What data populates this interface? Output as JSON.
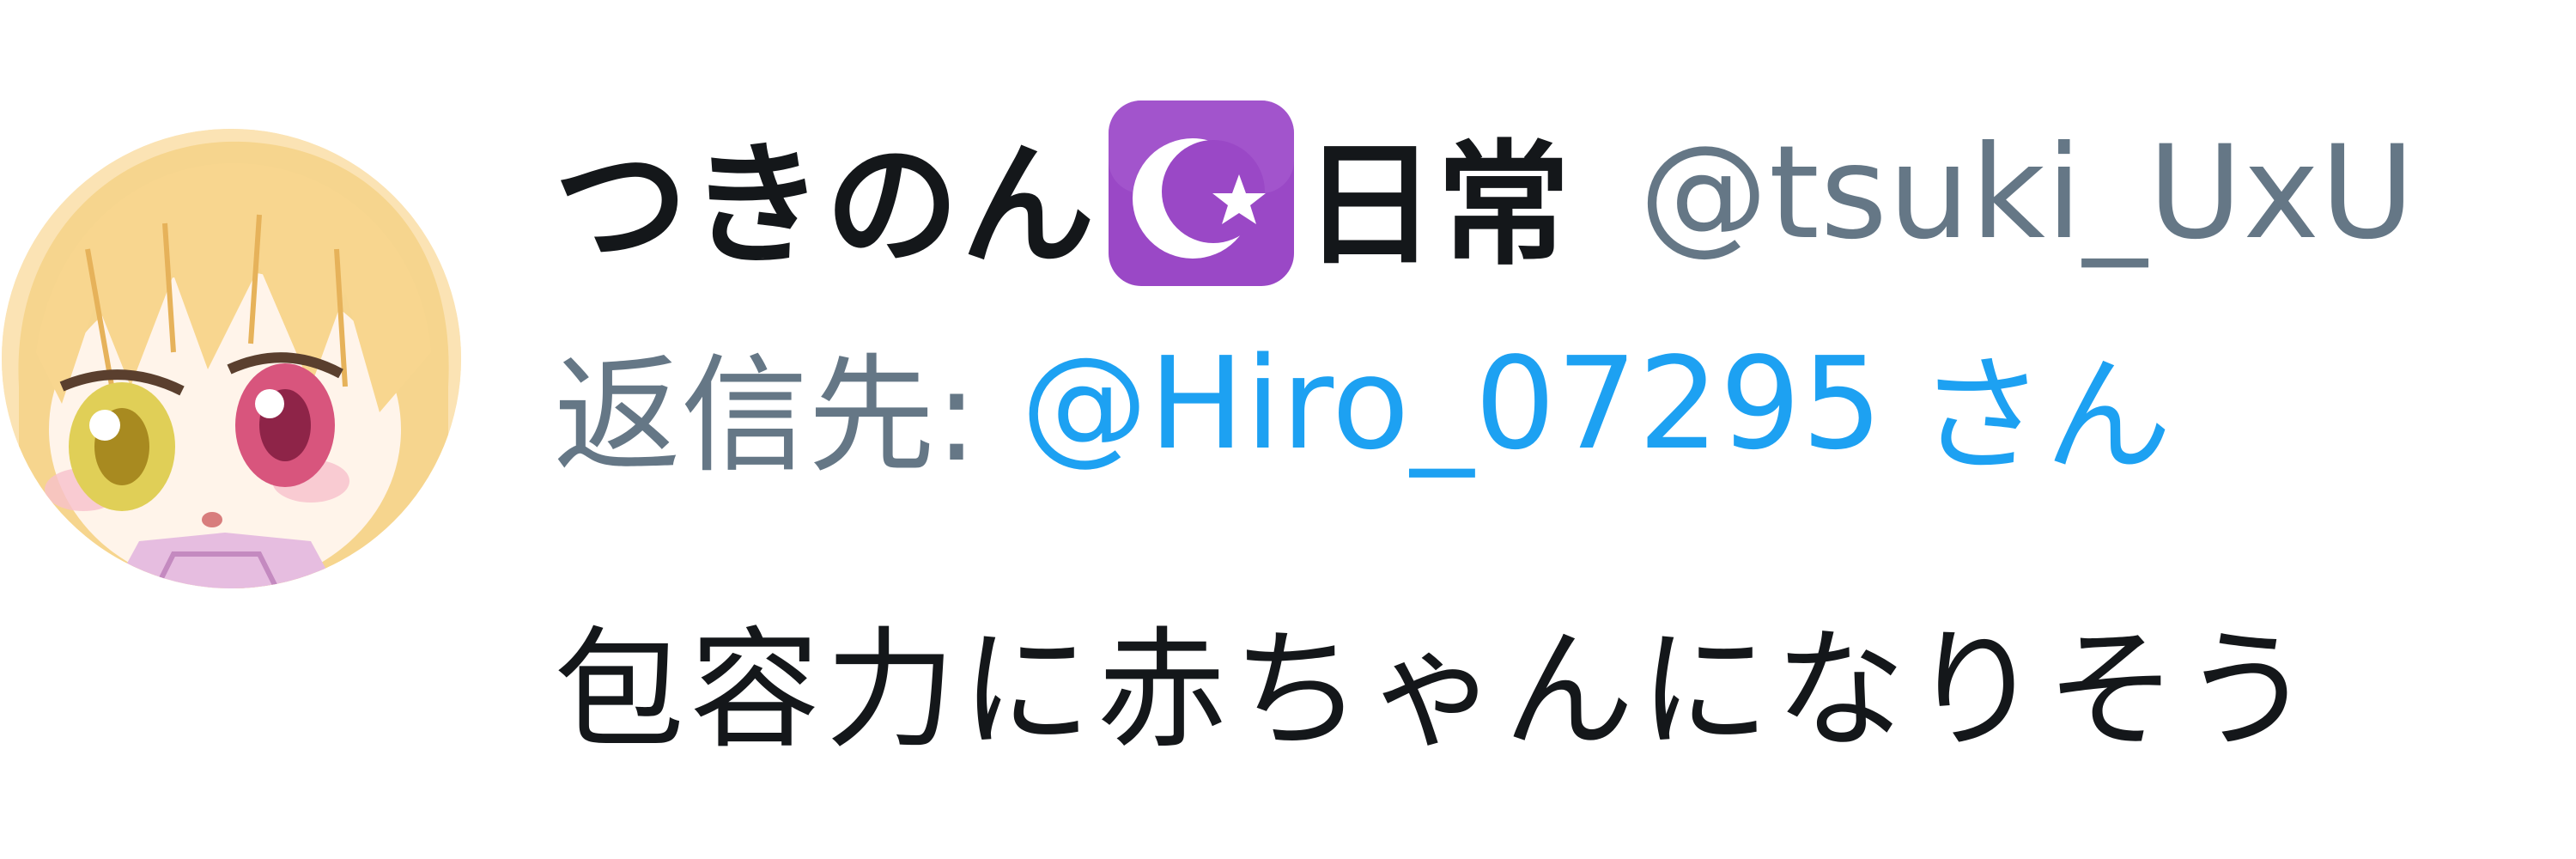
{
  "tweet": {
    "display_name": "つきのん",
    "name_emoji": "star-and-crescent-emoji",
    "name_suffix": "日常",
    "handle": "@tsuki_UxU",
    "reply": {
      "label": "返信先:",
      "mention": "@Hiro_07295",
      "honorific": "さん"
    },
    "text": "包容力に赤ちゃんになりそう"
  },
  "colors": {
    "primary_text": "#14171a",
    "secondary_text": "#657786",
    "link": "#1da1f2",
    "emoji_purple": "#9a48c6",
    "background": "#ffffff"
  }
}
